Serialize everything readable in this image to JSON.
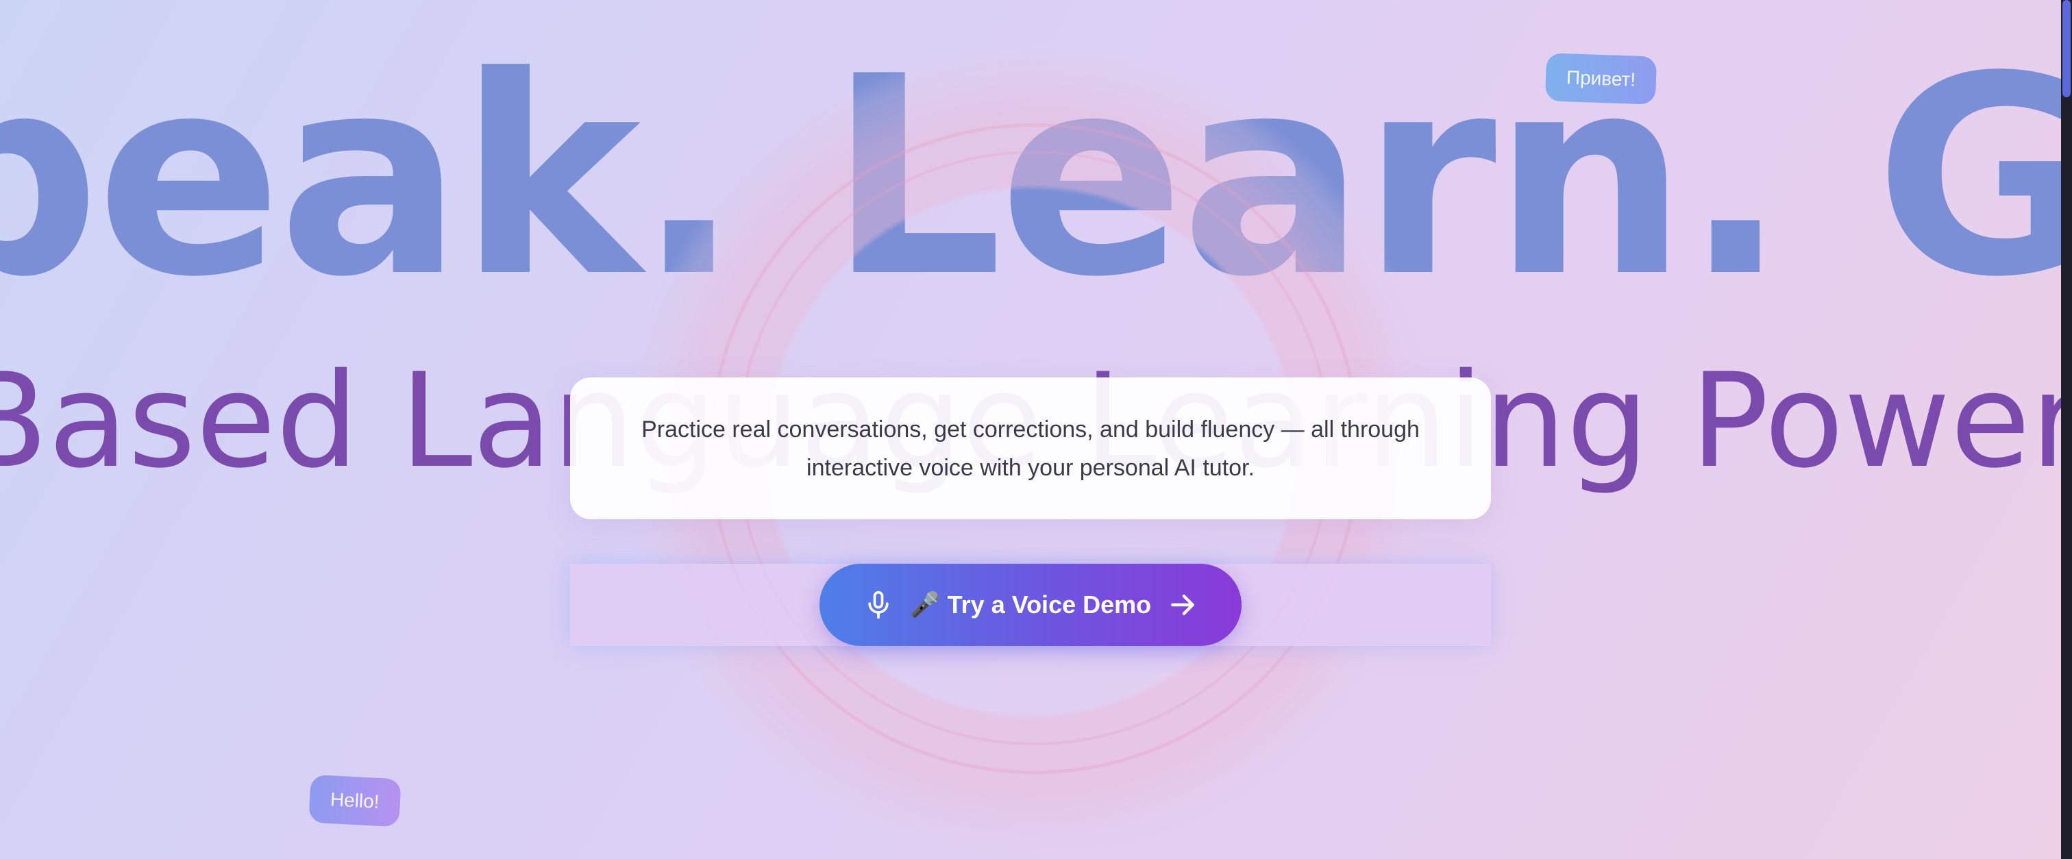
{
  "hero": {
    "headline": "peak. Learn. Grow",
    "subheadline": "Based Language Learning Powered"
  },
  "bubbles": {
    "russian": "Привет!",
    "english": "Hello!"
  },
  "description": {
    "text": "Practice real conversations, get corrections, and build fluency — all through interactive voice with your personal AI tutor."
  },
  "cta": {
    "label": "🎤 Try a Voice Demo",
    "leading_icon": "microphone-icon",
    "trailing_icon": "arrow-right-icon"
  },
  "colors": {
    "headline": "#7b8fd6",
    "subheadline": "#7a4bad",
    "button_start": "#4e7fe8",
    "button_end": "#8a3ad8"
  }
}
